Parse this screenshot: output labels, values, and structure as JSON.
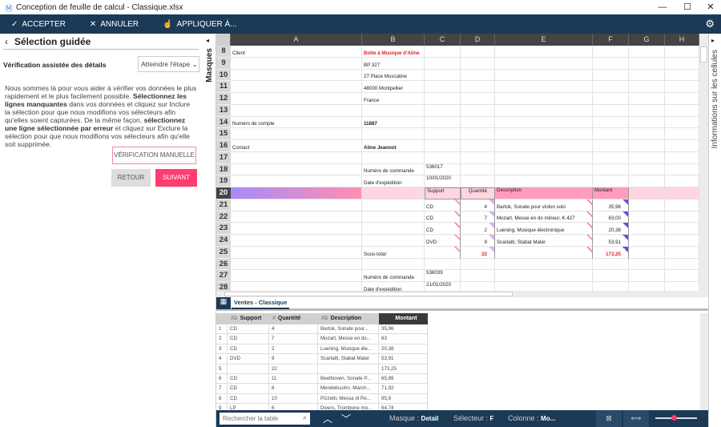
{
  "window": {
    "title": "Conception de feuille de calcul - Classique.xlsx",
    "minimize": "—",
    "maximize": "☐",
    "close": "✕"
  },
  "toolbar": {
    "accept": "ACCEPTER",
    "cancel": "ANNULER",
    "apply": "APPLIQUER À..."
  },
  "left_panel": {
    "title": "Sélection guidée",
    "subtitle": "Vérification assistée des détails",
    "step_select": "Atteindre l'étape",
    "para": [
      {
        "t": "Nous sommes là pour vous aider à vérifier vos données le plus rapidement et le plus facilement possible. ",
        "b": false
      },
      {
        "t": "Sélectionnez les lignes manquantes",
        "b": true
      },
      {
        "t": " dans vos données et cliquez sur Inclure la sélection pour que nous modifions vos sélecteurs afin qu'elles soient capturées. De la même façon, ",
        "b": false
      },
      {
        "t": "sélectionnez une ligne sélectionnée par erreur",
        "b": true
      },
      {
        "t": " et cliquez sur Exclure la sélection pour que nous modifions vos sélecteurs afin qu'elle soit supprimée.",
        "b": false
      }
    ],
    "manual": "VÉRIFICATION MANUELLE",
    "back": "RETOUR",
    "next": "SUIVANT"
  },
  "side_tabs": {
    "left": "Masques",
    "right": "Informations sur les cellules"
  },
  "sheet": {
    "columns": [
      "A",
      "B",
      "C",
      "D",
      "E",
      "F",
      "G",
      "H"
    ],
    "rows": [
      {
        "n": "8",
        "A": "Client",
        "B": "Boîte à Musique d'Aline"
      },
      {
        "n": "9",
        "B": "BP 327"
      },
      {
        "n": "10",
        "B": "27 Place Muscatine"
      },
      {
        "n": "11",
        "B": "48000 Montpellier"
      },
      {
        "n": "12",
        "B": "France"
      },
      {
        "n": "13"
      },
      {
        "n": "14",
        "A": "Numéro de compte",
        "B": "11887"
      },
      {
        "n": "15"
      },
      {
        "n": "16",
        "A": "Contact",
        "B": "Aline Jeannot"
      },
      {
        "n": "17"
      },
      {
        "n": "18",
        "B": "Numéro de commande",
        "C": "536017"
      },
      {
        "n": "19",
        "B": "Date d'expédition",
        "C": "10/01/2020"
      },
      {
        "n": "20",
        "C": "Support",
        "D": "Quantité",
        "E": "Description",
        "F": "Montant"
      },
      {
        "n": "21",
        "C": "CD",
        "D": "4",
        "E": "Bartok, Sonate pour violon solo",
        "F": "35,96"
      },
      {
        "n": "22",
        "C": "CD",
        "D": "7",
        "E": "Mozart, Messe en do mineur, K.427",
        "F": "63,00"
      },
      {
        "n": "23",
        "C": "CD",
        "D": "2",
        "E": "Luening, Musique électronique",
        "F": "20,38"
      },
      {
        "n": "24",
        "C": "DVD",
        "D": "9",
        "E": "Scarlatti, Stabat Mater",
        "F": "53,91"
      },
      {
        "n": "25",
        "B": "Sous-total",
        "D": "22",
        "F": "173,25"
      },
      {
        "n": "26"
      },
      {
        "n": "27",
        "B": "Numéro de commande",
        "C": "536039"
      },
      {
        "n": "28",
        "B": "Date d'expédition",
        "C": "21/01/2020"
      }
    ]
  },
  "sheet_tab": "Ventes - Classique",
  "table": {
    "headers": [
      {
        "icon": "Ab",
        "label": "Support"
      },
      {
        "icon": "#",
        "label": "Quantité"
      },
      {
        "icon": "Ab",
        "label": "Description"
      },
      {
        "icon": "",
        "label": "Montant"
      }
    ],
    "rows": [
      [
        "1",
        "CD",
        "4",
        "Bartok, Sonate pour...",
        "35,96"
      ],
      [
        "2",
        "CD",
        "7",
        "Mozart, Messe en do...",
        "63"
      ],
      [
        "3",
        "CD",
        "2",
        "Luening, Musique éle...",
        "20,38"
      ],
      [
        "4",
        "DVD",
        "9",
        "Scarlatti, Stabat Mater",
        "53,91"
      ],
      [
        "5",
        "",
        "22",
        "",
        "173,25"
      ],
      [
        "6",
        "CD",
        "11",
        "Beethoven, Sonate P...",
        "65,89"
      ],
      [
        "7",
        "CD",
        "8",
        "Mendelssohn, March...",
        "71,92"
      ],
      [
        "8",
        "CD",
        "10",
        "Pizzetti, Messa di Re...",
        "95,9"
      ],
      [
        "9",
        "LP",
        "6",
        "Divers, Trombone mo...",
        "64,74"
      ]
    ]
  },
  "status": {
    "search_placeholder": "Rechercher la table",
    "mask_label": "Masque :",
    "mask": "Detail",
    "selector_label": "Sélecteur :",
    "selector": "F",
    "column_label": "Colonne :",
    "column": "Mo...",
    "zoom": 0.45
  },
  "colors": {
    "toolbar": "#1b3a57",
    "accent": "#ff3d6e",
    "highlight_row": "#ffd6df",
    "header_pink": "#ff8fb1",
    "red_text": "#e0202a"
  }
}
